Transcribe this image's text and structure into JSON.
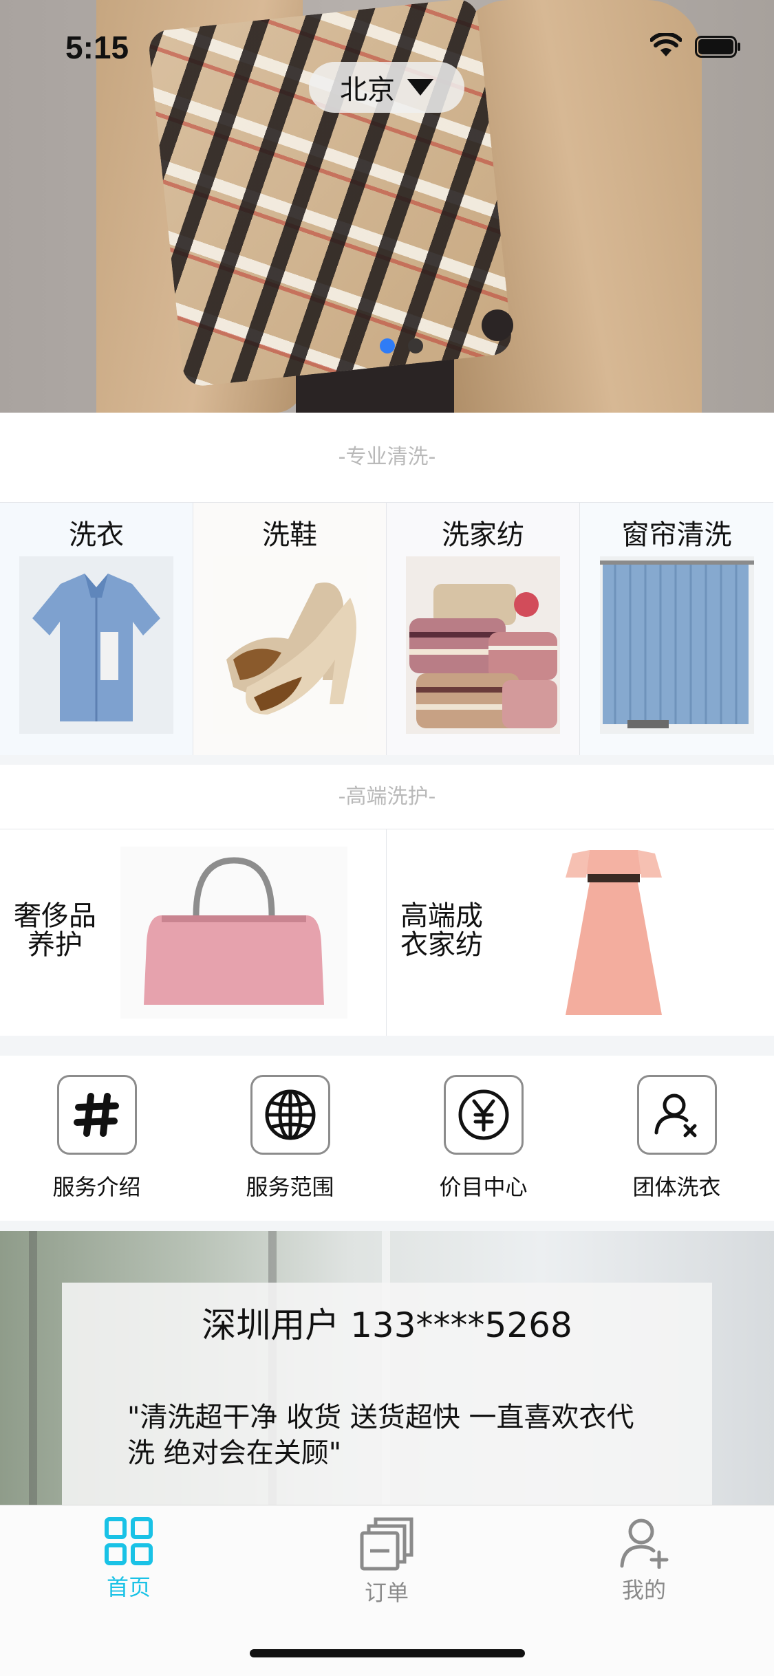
{
  "status": {
    "time": "5:15"
  },
  "location": {
    "city": "北京"
  },
  "banner": {
    "pages": 2,
    "active_page": 1,
    "active_color": "#2f7cf6"
  },
  "sections": {
    "professional": "-专业清洗-",
    "premium": "-高端洗护-"
  },
  "services": [
    {
      "label": "洗衣"
    },
    {
      "label": "洗鞋"
    },
    {
      "label": "洗家纺"
    },
    {
      "label": "窗帘清洗"
    }
  ],
  "premium": [
    {
      "line1": "奢侈品",
      "line2": "养护"
    },
    {
      "line1": "高端成",
      "line2": "衣家纺"
    }
  ],
  "quick_links": [
    {
      "label": "服务介绍",
      "icon": "hash-icon"
    },
    {
      "label": "服务范围",
      "icon": "globe-icon"
    },
    {
      "label": "价目中心",
      "icon": "yen-icon"
    },
    {
      "label": "团体洗衣",
      "icon": "user-cancel-icon"
    }
  ],
  "review": {
    "user": "深圳用户 133****5268",
    "text": "\"清洗超干净 收货 送货超快 一直喜欢衣代洗 绝对会在关顾\""
  },
  "tabbar": {
    "active_color": "#19c2e6",
    "inactive_color": "#8a8a8a",
    "items": [
      {
        "label": "首页",
        "icon": "grid-icon",
        "active": true
      },
      {
        "label": "订单",
        "icon": "order-stack-icon",
        "active": false
      },
      {
        "label": "我的",
        "icon": "user-add-icon",
        "active": false
      }
    ]
  }
}
